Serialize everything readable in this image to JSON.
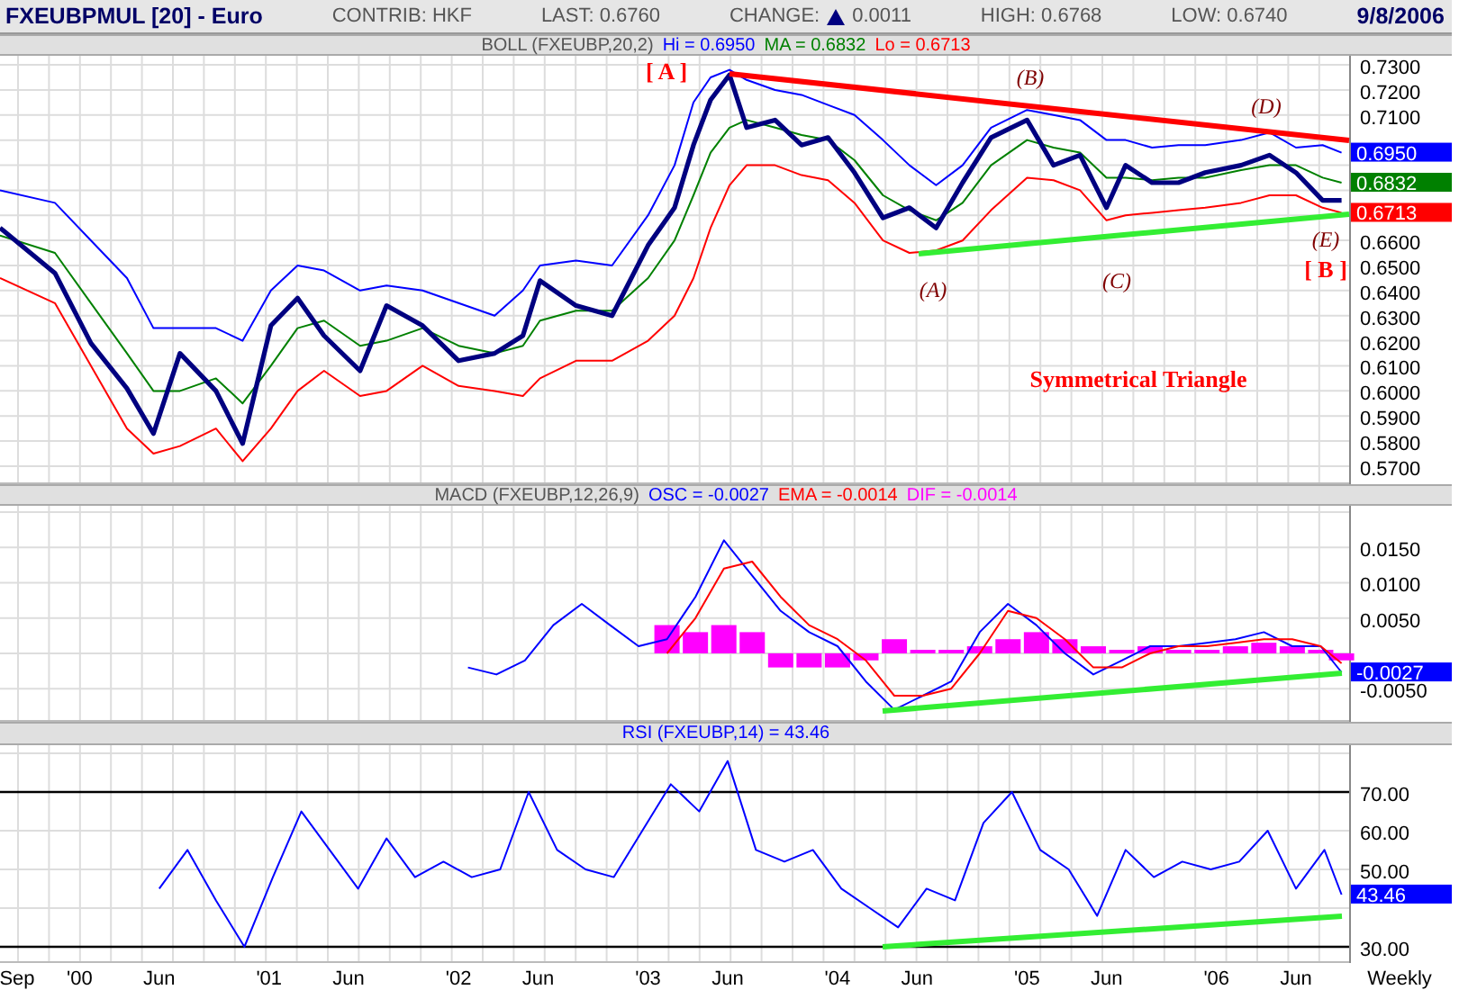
{
  "header": {
    "symbol": "FXEUBPMUL [20] - Euro",
    "contrib": "CONTRIB: HKF",
    "last": "LAST: 0.6760",
    "change_label": "CHANGE:",
    "change": "0.0011",
    "high": "HIGH: 0.6768",
    "low": "LOW: 0.6740",
    "date": "9/8/2006"
  },
  "panels": [
    {
      "legend": [
        {
          "text": "BOLL (FXEUBP,20,2)",
          "color": "#555555"
        },
        {
          "text": "Hi = 0.6950",
          "color": "#0000ff"
        },
        {
          "text": "MA = 0.6832",
          "color": "#008000"
        },
        {
          "text": "Lo = 0.6713",
          "color": "#ff0000"
        }
      ],
      "value_tags": [
        {
          "text": "0.6950",
          "color": "#0000ff"
        },
        {
          "text": "0.6832",
          "color": "#008000"
        },
        {
          "text": "0.6713",
          "color": "#ff0000"
        }
      ],
      "chart_data": {
        "type": "line",
        "grid": true,
        "xlim": [
          1999.58,
          2006.7
        ],
        "ylim": [
          0.5628,
          0.7336
        ],
        "x": [
          1999.58,
          1999.87,
          2000.06,
          2000.25,
          2000.39,
          2000.53,
          2000.72,
          2000.86,
          2001.01,
          2001.15,
          2001.29,
          2001.48,
          2001.62,
          2001.81,
          2002.0,
          2002.19,
          2002.34,
          2002.43,
          2002.62,
          2002.81,
          2003.0,
          2003.14,
          2003.24,
          2003.33,
          2003.43,
          2003.52,
          2003.67,
          2003.81,
          2003.95,
          2004.09,
          2004.24,
          2004.38,
          2004.52,
          2004.66,
          2004.81,
          2005.0,
          2005.14,
          2005.28,
          2005.42,
          2005.52,
          2005.66,
          2005.8,
          2005.94,
          2006.13,
          2006.28,
          2006.42,
          2006.56,
          2006.66
        ],
        "series": [
          {
            "color": "#0000ff",
            "values": [
              0.68,
              0.675,
              0.66,
              0.645,
              0.625,
              0.625,
              0.625,
              0.62,
              0.64,
              0.65,
              0.648,
              0.64,
              0.642,
              0.64,
              0.635,
              0.63,
              0.64,
              0.65,
              0.652,
              0.65,
              0.67,
              0.69,
              0.715,
              0.725,
              0.728,
              0.724,
              0.72,
              0.718,
              0.714,
              0.71,
              0.7,
              0.69,
              0.682,
              0.69,
              0.705,
              0.712,
              0.71,
              0.708,
              0.7,
              0.7,
              0.697,
              0.698,
              0.698,
              0.7,
              0.703,
              0.697,
              0.698,
              0.695
            ]
          },
          {
            "color": "#008000",
            "values": [
              0.662,
              0.655,
              0.635,
              0.615,
              0.6,
              0.6,
              0.605,
              0.595,
              0.61,
              0.625,
              0.628,
              0.618,
              0.62,
              0.625,
              0.618,
              0.615,
              0.618,
              0.628,
              0.632,
              0.632,
              0.645,
              0.66,
              0.678,
              0.695,
              0.705,
              0.708,
              0.705,
              0.702,
              0.7,
              0.692,
              0.678,
              0.672,
              0.668,
              0.675,
              0.69,
              0.7,
              0.697,
              0.695,
              0.685,
              0.685,
              0.684,
              0.685,
              0.685,
              0.688,
              0.69,
              0.69,
              0.685,
              0.683
            ]
          },
          {
            "color": "#ff0000",
            "values": [
              0.645,
              0.635,
              0.61,
              0.585,
              0.575,
              0.578,
              0.585,
              0.572,
              0.585,
              0.6,
              0.608,
              0.598,
              0.6,
              0.61,
              0.602,
              0.6,
              0.598,
              0.605,
              0.612,
              0.612,
              0.62,
              0.63,
              0.645,
              0.665,
              0.682,
              0.69,
              0.69,
              0.686,
              0.684,
              0.675,
              0.66,
              0.655,
              0.656,
              0.66,
              0.672,
              0.685,
              0.684,
              0.68,
              0.668,
              0.67,
              0.671,
              0.672,
              0.673,
              0.675,
              0.678,
              0.678,
              0.673,
              0.671
            ]
          },
          {
            "color": "#000080",
            "values": [
              0.665,
              0.647,
              0.619,
              0.601,
              0.583,
              0.615,
              0.6,
              0.579,
              0.626,
              0.637,
              0.622,
              0.608,
              0.634,
              0.626,
              0.612,
              0.615,
              0.622,
              0.644,
              0.634,
              0.63,
              0.658,
              0.673,
              0.698,
              0.716,
              0.726,
              0.705,
              0.708,
              0.698,
              0.701,
              0.687,
              0.669,
              0.673,
              0.665,
              0.683,
              0.701,
              0.708,
              0.69,
              0.694,
              0.673,
              0.69,
              0.683,
              0.683,
              0.687,
              0.69,
              0.694,
              0.687,
              0.676,
              0.676
            ]
          }
        ],
        "yticks": [
          {
            "value": 0.73,
            "label": "0.7300"
          },
          {
            "value": 0.72,
            "label": "0.7200"
          },
          {
            "value": 0.71,
            "label": "0.7100"
          },
          {
            "value": 0.66,
            "label": "0.6600"
          },
          {
            "value": 0.65,
            "label": "0.6500"
          },
          {
            "value": 0.64,
            "label": "0.6400"
          },
          {
            "value": 0.63,
            "label": "0.6300"
          },
          {
            "value": 0.62,
            "label": "0.6200"
          },
          {
            "value": 0.61,
            "label": "0.6100"
          },
          {
            "value": 0.6,
            "label": "0.6000"
          },
          {
            "value": 0.59,
            "label": "0.5900"
          },
          {
            "value": 0.58,
            "label": "0.5800"
          },
          {
            "value": 0.57,
            "label": "0.5700"
          }
        ],
        "annotations": [
          "[ A ]",
          "(B)",
          "(D)",
          "(A)",
          "(C)",
          "(E)",
          "[ B ]",
          "Symmetrical Triangle"
        ]
      }
    },
    {
      "legend": [
        {
          "text": "MACD (FXEUBP,12,26,9)",
          "color": "#555555"
        },
        {
          "text": "OSC = -0.0027",
          "color": "#0000ff"
        },
        {
          "text": "EMA = -0.0014",
          "color": "#ff0000"
        },
        {
          "text": "DIF = -0.0014",
          "color": "#ff00ff"
        }
      ],
      "value_tags": [
        {
          "text": "-0.0027",
          "color": "#0000ff"
        }
      ],
      "chart_data": {
        "type": "line",
        "grid": true,
        "xlim": [
          1999.58,
          2006.7
        ],
        "ylim": [
          -0.0097,
          0.0209
        ],
        "x": [
          2002.05,
          2002.2,
          2002.35,
          2002.5,
          2002.65,
          2002.8,
          2002.95,
          2003.1,
          2003.25,
          2003.4,
          2003.55,
          2003.7,
          2003.85,
          2004.0,
          2004.15,
          2004.3,
          2004.45,
          2004.6,
          2004.75,
          2004.9,
          2005.05,
          2005.2,
          2005.35,
          2005.5,
          2005.65,
          2005.8,
          2005.95,
          2006.1,
          2006.25,
          2006.4,
          2006.55,
          2006.66
        ],
        "series": [
          {
            "color": "#0000ff",
            "values": [
              -0.002,
              -0.003,
              -0.001,
              0.004,
              0.007,
              0.004,
              0.001,
              0.002,
              0.008,
              0.016,
              0.011,
              0.006,
              0.003,
              0.001,
              -0.004,
              -0.008,
              -0.006,
              -0.004,
              0.003,
              0.007,
              0.004,
              0.0,
              -0.003,
              -0.001,
              0.001,
              0.001,
              0.0015,
              0.002,
              0.003,
              0.001,
              0.001,
              -0.0027
            ]
          },
          {
            "color": "#ff0000",
            "values": [
              null,
              null,
              null,
              null,
              null,
              null,
              null,
              0.0,
              0.005,
              0.012,
              0.013,
              0.008,
              0.004,
              0.002,
              -0.001,
              -0.006,
              -0.006,
              -0.005,
              0.0,
              0.006,
              0.005,
              0.002,
              -0.002,
              -0.002,
              0.0,
              0.001,
              0.001,
              0.0015,
              0.002,
              0.002,
              0.001,
              -0.0014
            ]
          },
          {
            "type": "bar",
            "color": "#ff00ff",
            "values": [
              null,
              null,
              null,
              null,
              null,
              null,
              null,
              0.004,
              0.003,
              0.004,
              0.003,
              -0.002,
              -0.002,
              -0.002,
              -0.001,
              0.002,
              0.0005,
              0.0005,
              0.001,
              0.002,
              0.003,
              0.002,
              0.001,
              0.0005,
              0.001,
              0.0005,
              0.0005,
              0.001,
              0.0015,
              0.001,
              0.0005,
              -0.001
            ]
          }
        ],
        "yticks": [
          {
            "value": 0.015,
            "label": "0.0150"
          },
          {
            "value": 0.01,
            "label": "0.0100"
          },
          {
            "value": 0.005,
            "label": "0.0050"
          },
          {
            "value": -0.005,
            "label": "-0.0050"
          }
        ]
      }
    },
    {
      "legend": [
        {
          "text": "RSI (FXEUBP,14) = 43.46",
          "color": "#0000ff"
        }
      ],
      "value_tags": [
        {
          "text": "43.46",
          "color": "#0000ff"
        }
      ],
      "period": "Weekly",
      "chart_data": {
        "type": "line",
        "grid": true,
        "xlim": [
          1999.58,
          2006.7
        ],
        "ylim": [
          25.8,
          82.1
        ],
        "x": [
          2000.42,
          2000.57,
          2000.72,
          2000.87,
          2001.02,
          2001.17,
          2001.32,
          2001.47,
          2001.62,
          2001.77,
          2001.92,
          2002.07,
          2002.22,
          2002.37,
          2002.52,
          2002.67,
          2002.82,
          2002.97,
          2003.12,
          2003.27,
          2003.42,
          2003.57,
          2003.72,
          2003.87,
          2004.02,
          2004.17,
          2004.32,
          2004.47,
          2004.62,
          2004.77,
          2004.92,
          2005.07,
          2005.22,
          2005.37,
          2005.52,
          2005.67,
          2005.82,
          2005.97,
          2006.12,
          2006.27,
          2006.42,
          2006.57,
          2006.66
        ],
        "series": [
          {
            "color": "#0000ff",
            "values": [
              45,
              55,
              42,
              30,
              48,
              65,
              55,
              45,
              58,
              48,
              52,
              48,
              50,
              70,
              55,
              50,
              48,
              60,
              72,
              65,
              78,
              55,
              52,
              55,
              45,
              40,
              35,
              45,
              42,
              62,
              70,
              55,
              50,
              38,
              55,
              48,
              52,
              50,
              52,
              60,
              45,
              55,
              43.5
            ]
          }
        ],
        "yticks": [
          {
            "value": 70,
            "label": "70.00"
          },
          {
            "value": 60,
            "label": "60.00"
          },
          {
            "value": 50,
            "label": "50.00"
          },
          {
            "value": 30,
            "label": "30.00"
          }
        ],
        "xticks": [
          {
            "value": 1999.67,
            "label": "Sep"
          },
          {
            "value": 2000.0,
            "label": "'00"
          },
          {
            "value": 2000.42,
            "label": "Jun"
          },
          {
            "value": 2001.0,
            "label": "'01"
          },
          {
            "value": 2001.42,
            "label": "Jun"
          },
          {
            "value": 2002.0,
            "label": "'02"
          },
          {
            "value": 2002.42,
            "label": "Jun"
          },
          {
            "value": 2003.0,
            "label": "'03"
          },
          {
            "value": 2003.42,
            "label": "Jun"
          },
          {
            "value": 2004.0,
            "label": "'04"
          },
          {
            "value": 2004.42,
            "label": "Jun"
          },
          {
            "value": 2005.0,
            "label": "'05"
          },
          {
            "value": 2005.42,
            "label": "Jun"
          },
          {
            "value": 2006.0,
            "label": "'06"
          },
          {
            "value": 2006.42,
            "label": "Jun"
          }
        ]
      }
    }
  ]
}
